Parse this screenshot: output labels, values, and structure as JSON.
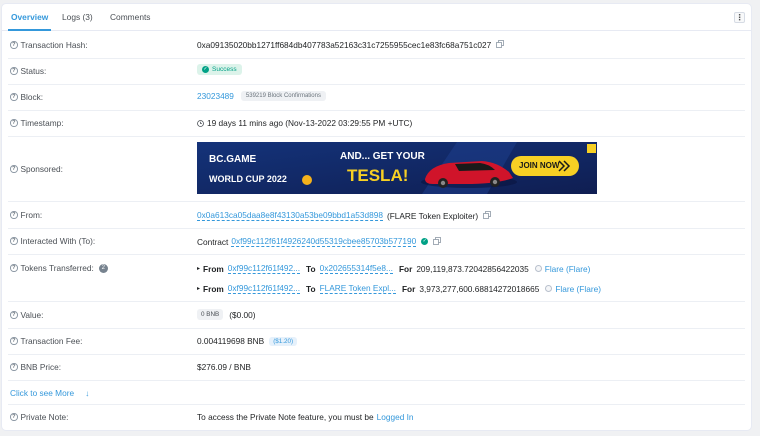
{
  "tabs": [
    {
      "label": "Overview"
    },
    {
      "label": "Logs (3)"
    },
    {
      "label": "Comments"
    }
  ],
  "more_button": "⋮",
  "colors": {
    "accent": "#3498db",
    "success": "#00a186",
    "banner_bg": "#1a2a6c"
  },
  "rows": {
    "hash": {
      "label": "Transaction Hash:",
      "value": "0xa09135020bb1271ff684db407783a52163c31c7255955cec1e83fc68a751c027"
    },
    "status": {
      "label": "Status:",
      "value": "Success"
    },
    "block": {
      "label": "Block:",
      "value": "23023489",
      "confirmations": "539219 Block Confirmations"
    },
    "timestamp": {
      "label": "Timestamp:",
      "value": "19 days 11 mins ago (Nov-13-2022 03:29:55 PM +UTC)"
    },
    "sponsored": {
      "label": "Sponsored:",
      "banner": {
        "brand": "BC.GAME",
        "headline": "AND... GET YOUR",
        "big": "TESLA!",
        "sub": "WORLD CUP 2022",
        "cta": "JOIN NOW"
      }
    },
    "from": {
      "label": "From:",
      "address": "0x0a613ca05daa8e8f43130a53be09bbd1a53d898",
      "name": "(FLARE Token Exploiter)"
    },
    "interacted": {
      "label": "Interacted With (To):",
      "prefix": "Contract",
      "address": "0xf99c112f61f4926240d55319cbee85703b577190"
    },
    "tokens": {
      "label": "Tokens Transferred:",
      "count": "2",
      "transfers": [
        {
          "from_word": "From",
          "from": "0xf99c112f61f492...",
          "to_word": "To",
          "to": "0x202655314f5e8...",
          "for_word": "For",
          "amount": "209,119,873.72042856422035",
          "token": "Flare (Flare)"
        },
        {
          "from_word": "From",
          "from": "0xf99c112f61f492...",
          "to_word": "To",
          "to": "FLARE Token Expl...",
          "for_word": "For",
          "amount": "3,973,277,600.68814272018665",
          "token": "Flare (Flare)"
        }
      ]
    },
    "value": {
      "label": "Value:",
      "pill": "0 BNB",
      "usd": "($0.00)"
    },
    "fee": {
      "label": "Transaction Fee:",
      "value": "0.004119698 BNB",
      "usd": "($1.20)"
    },
    "price": {
      "label": "BNB Price:",
      "value": "$276.09 / BNB"
    },
    "more": {
      "label": "Click to see More"
    },
    "note": {
      "label": "Private Note:",
      "text": "To access the Private Note feature, you must be",
      "link": "Logged In"
    }
  }
}
